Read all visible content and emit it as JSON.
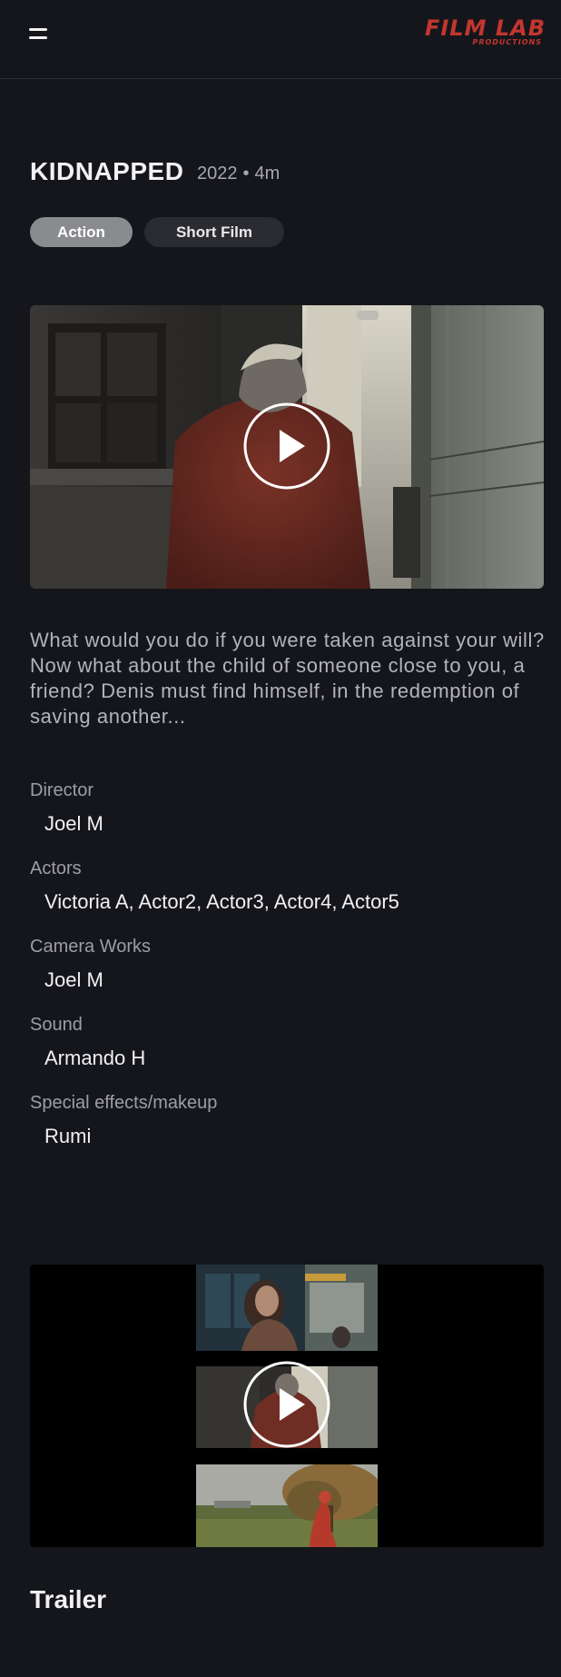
{
  "header": {
    "logo_main": "FILM LAB",
    "logo_sub": "PRODUCTIONS",
    "logo_color": "#c2362f",
    "menu_icon": "hamburger-menu-icon"
  },
  "film": {
    "title": "KIDNAPPED",
    "year": "2022",
    "separator": "•",
    "duration": "4m",
    "tags": [
      "Action",
      "Short Film"
    ],
    "description": "What would you do if you were taken against your will? Now what about the child of someone close to you, a friend? Denis must find himself, in the redemption of saving another...",
    "credits": [
      {
        "label": "Director",
        "value": "Joel M"
      },
      {
        "label": "Actors",
        "value": "Victoria A, Actor2, Actor3, Actor4, Actor5"
      },
      {
        "label": "Camera Works",
        "value": "Joel M"
      },
      {
        "label": "Sound",
        "value": "Armando H"
      },
      {
        "label": "Special effects/makeup",
        "value": "Rumi"
      }
    ]
  },
  "trailer": {
    "heading": "Trailer",
    "play_icon": "play-icon"
  },
  "colors": {
    "background": "#15161b",
    "tag_active": "#8a8b8f",
    "tag_inactive": "#2b2c31"
  }
}
